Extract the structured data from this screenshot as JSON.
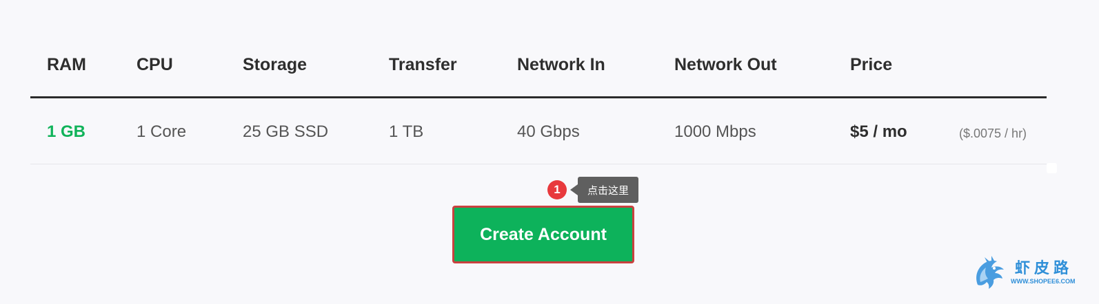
{
  "table": {
    "headers": [
      "RAM",
      "CPU",
      "Storage",
      "Transfer",
      "Network In",
      "Network Out",
      "Price"
    ],
    "row": {
      "ram": "1 GB",
      "cpu": "1 Core",
      "storage": "25 GB SSD",
      "transfer": "1 TB",
      "network_in": "40 Gbps",
      "network_out": "1000 Mbps",
      "price": "$5 / mo",
      "hourly": "($.0075 / hr)"
    }
  },
  "annotation": {
    "step_number": "1",
    "tooltip_text": "点击这里"
  },
  "cta": {
    "label": "Create Account"
  },
  "watermark": {
    "title": "虾皮路",
    "url": "WWW.SHOPEE6.COM"
  },
  "colors": {
    "accent_green": "#0db25b",
    "ram_green": "#11b35a",
    "highlight_red": "#c9413f",
    "badge_red": "#e8393d",
    "tooltip_gray": "#5f5f5f",
    "watermark_blue": "#2f8fd8"
  },
  "icons": {
    "watermark_logo": "dragon-logo-icon"
  }
}
